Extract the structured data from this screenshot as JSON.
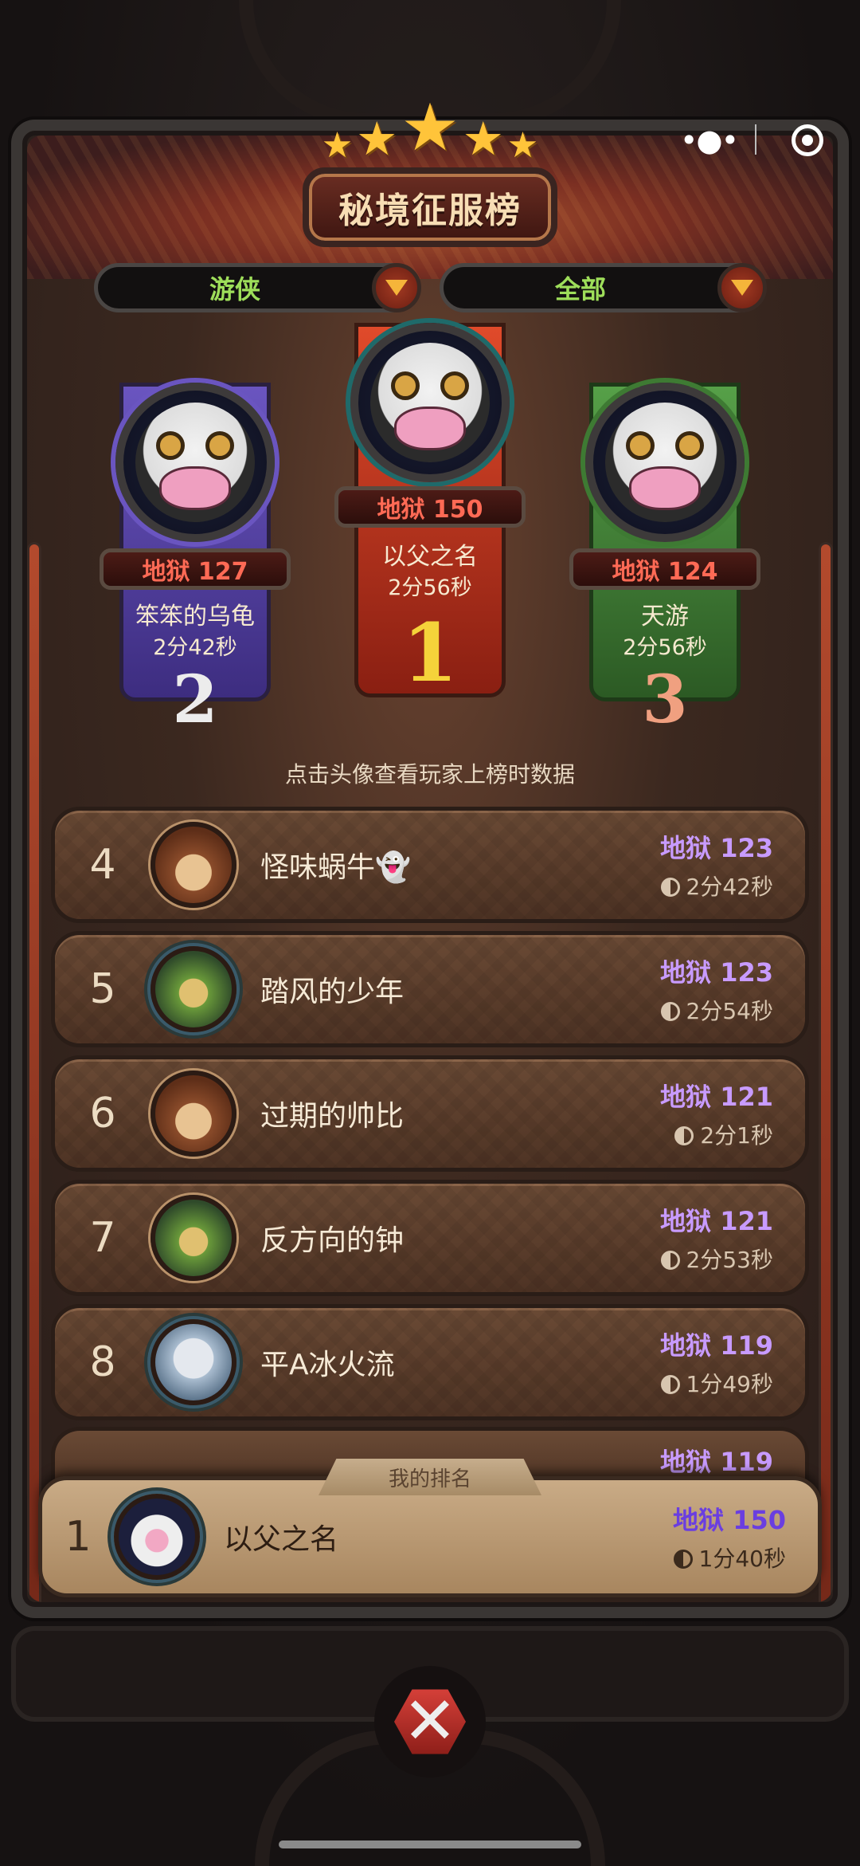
{
  "header": {
    "title": "秘境征服榜",
    "stars": 5
  },
  "filters": {
    "class": "游侠",
    "scope": "全部"
  },
  "podium": [
    {
      "rank": "1",
      "score": "地狱 150",
      "name": "以父之名",
      "time": "2分56秒",
      "color": "#c8351e"
    },
    {
      "rank": "2",
      "score": "地狱 127",
      "name": "笨笨的乌龟",
      "time": "2分42秒",
      "color": "#4b3a9a"
    },
    {
      "rank": "3",
      "score": "地狱 124",
      "name": "天游",
      "time": "2分56秒",
      "color": "#3e7a33"
    }
  ],
  "hint": "点击头像查看玩家上榜时数据",
  "rows": [
    {
      "rank": "4",
      "name": "怪味蜗牛👻",
      "score": "地狱 123",
      "time": "2分42秒",
      "avatar": "bear"
    },
    {
      "rank": "5",
      "name": "踏风的少年",
      "score": "地狱 123",
      "time": "2分54秒",
      "avatar": "fox"
    },
    {
      "rank": "6",
      "name": "过期的帅比",
      "score": "地狱 121",
      "time": "2分1秒",
      "avatar": "bear"
    },
    {
      "rank": "7",
      "name": "反方向的钟",
      "score": "地狱 121",
      "time": "2分53秒",
      "avatar": "fox"
    },
    {
      "rank": "8",
      "name": "平A冰火流",
      "score": "地狱 119",
      "time": "1分49秒",
      "avatar": "photo"
    }
  ],
  "partial_row": {
    "score": "地狱 119"
  },
  "my_rank": {
    "tab": "我的排名",
    "rank": "1",
    "name": "以父之名",
    "score": "地狱 150",
    "time": "1分40秒"
  },
  "icons": [
    "more-dots-icon",
    "target-icon",
    "dropdown-arrow-icon",
    "close-x-icon",
    "clock-icon"
  ]
}
